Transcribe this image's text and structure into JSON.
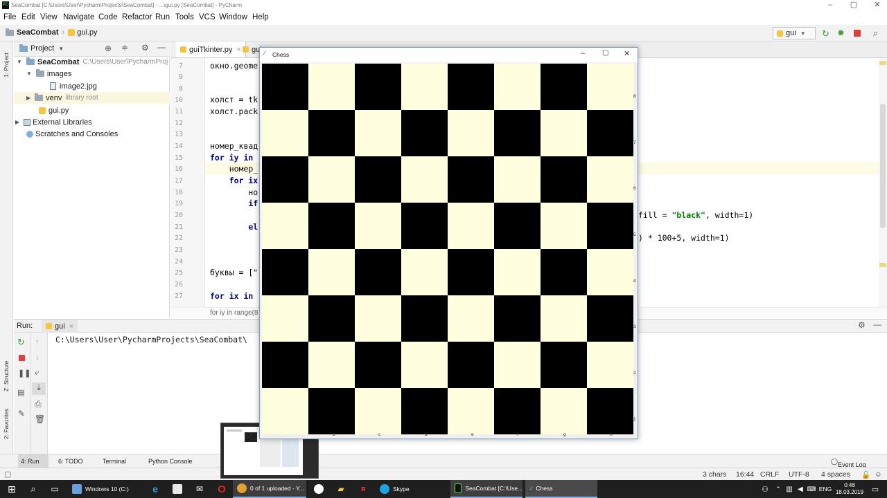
{
  "titlebar": {
    "title": "SeaCombat [C:\\Users\\User\\PycharmProjects\\SeaCombat] - ...\\gui.py [SeaCombat] - PyCharm",
    "app_icon": "PC"
  },
  "menu": [
    "File",
    "Edit",
    "View",
    "Navigate",
    "Code",
    "Refactor",
    "Run",
    "Tools",
    "VCS",
    "Window",
    "Help"
  ],
  "nav": {
    "project": "SeaCombat",
    "file": "gui.py",
    "run_config": "gui"
  },
  "sidebar": {
    "left_top": "1: Project",
    "left_mid": "Z: Structure",
    "left_bottom": "2: Favorites"
  },
  "project_panel": {
    "header": "Project",
    "items": [
      {
        "label": "SeaCombat",
        "hint": "C:\\Users\\User\\PycharmProj"
      },
      {
        "label": "images",
        "hint": ""
      },
      {
        "label": "image2.jpg",
        "hint": ""
      },
      {
        "label": "venv",
        "hint": "library root"
      },
      {
        "label": "gui.py",
        "hint": ""
      },
      {
        "label": "External Libraries",
        "hint": ""
      },
      {
        "label": "Scratches and Consoles",
        "hint": ""
      }
    ]
  },
  "editor": {
    "tabs": [
      {
        "label": "guiTkinter.py"
      },
      {
        "label": "gui"
      }
    ],
    "lines": [
      {
        "n": "7",
        "text": "окно.geome"
      },
      {
        "n": "8",
        "text": ""
      },
      {
        "n": "9",
        "text": ""
      },
      {
        "n": "10",
        "text": "холст = tk"
      },
      {
        "n": "11",
        "text": "холст.pack"
      },
      {
        "n": "12",
        "text": ""
      },
      {
        "n": "13",
        "text": ""
      },
      {
        "n": "14",
        "text": "номер_квад"
      },
      {
        "n": "15",
        "text": "for iy in"
      },
      {
        "n": "16",
        "text": "    номер_"
      },
      {
        "n": "17",
        "text": "    for ix"
      },
      {
        "n": "18",
        "text": "        но"
      },
      {
        "n": "19",
        "text": "        if"
      },
      {
        "n": "20",
        "text": ""
      },
      {
        "n": "21",
        "text": "        el"
      },
      {
        "n": "22",
        "text": ""
      },
      {
        "n": "23",
        "text": ""
      },
      {
        "n": "24",
        "text": ""
      },
      {
        "n": "25",
        "text": "буквы = [\""
      },
      {
        "n": "26",
        "text": ""
      },
      {
        "n": "27",
        "text": "for ix in"
      }
    ],
    "right_line1_a": "fill = ",
    "right_line1_b": "\"black\"",
    "right_line1_c": ", width=1)",
    "right_line2": ") * 100+5, width=1)",
    "breadcrumb": "for iy in range(8"
  },
  "run_panel": {
    "label": "Run:",
    "config": "gui",
    "output": "C:\\Users\\User\\PycharmProjects\\SeaCombat\\"
  },
  "bottom_tabs": [
    "4: Run",
    "6: TODO",
    "Terminal",
    "Python Console"
  ],
  "event_log": "Event Log",
  "status": {
    "chars": "3 chars",
    "position": "16:44",
    "line_sep": "CRLF",
    "encoding": "UTF-8",
    "indent": "4 spaces"
  },
  "taskbar": {
    "items": [
      "Windows 10 (C:)",
      "0 of 1 uploaded - Y...",
      "Skype",
      "SeaCombat [C:\\Use...",
      "Chess"
    ],
    "lang": "ENG",
    "time": "0:48",
    "date": "18.03.2019"
  },
  "chess_window": {
    "title": "Chess",
    "ranks": [
      "8",
      "7",
      "6",
      "5",
      "4",
      "3",
      "2",
      "1"
    ],
    "files": [
      "b",
      "c",
      "d",
      "e",
      "f",
      "g",
      "h"
    ],
    "light_color": "#ffffe0",
    "dark_color": "#000000"
  }
}
